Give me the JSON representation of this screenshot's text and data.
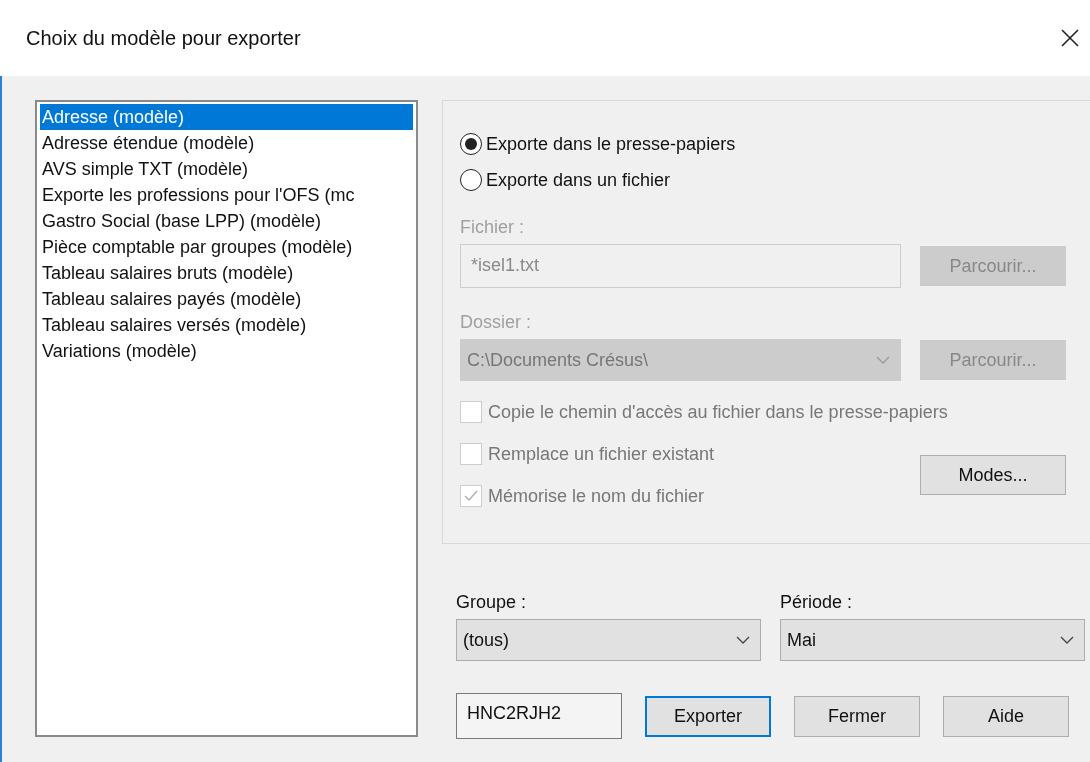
{
  "window": {
    "title": "Choix du modèle pour exporter"
  },
  "models": [
    {
      "label": "Adresse (modèle)",
      "selected": true
    },
    {
      "label": "Adresse étendue (modèle)",
      "selected": false
    },
    {
      "label": "AVS simple TXT (modèle)",
      "selected": false
    },
    {
      "label": "Exporte les professions pour l'OFS (mc",
      "selected": false
    },
    {
      "label": "Gastro Social (base LPP) (modèle)",
      "selected": false
    },
    {
      "label": "Pièce comptable par groupes (modèle)",
      "selected": false
    },
    {
      "label": "Tableau salaires bruts (modèle)",
      "selected": false
    },
    {
      "label": "Tableau salaires payés (modèle)",
      "selected": false
    },
    {
      "label": "Tableau salaires versés (modèle)",
      "selected": false
    },
    {
      "label": "Variations (modèle)",
      "selected": false
    }
  ],
  "export_targets": [
    {
      "label": "Exporte dans le presse-papiers",
      "selected": true
    },
    {
      "label": "Exporte dans un fichier",
      "selected": false
    }
  ],
  "file": {
    "label": "Fichier :",
    "value": "*isel1.txt",
    "browse": "Parcourir...",
    "disabled": true
  },
  "folder": {
    "label": "Dossier :",
    "value": "C:\\Documents Crésus\\",
    "browse": "Parcourir...",
    "disabled": true
  },
  "options": [
    {
      "label": "Copie le chemin d'accès au fichier dans le presse-papiers",
      "checked": false,
      "disabled": true
    },
    {
      "label": "Remplace un fichier existant",
      "checked": false,
      "disabled": true
    },
    {
      "label": "Mémorise le nom du fichier",
      "checked": true,
      "disabled": true
    }
  ],
  "modes_button": "Modes...",
  "group": {
    "label": "Groupe :",
    "value": "(tous)"
  },
  "period": {
    "label": "Période :",
    "value": "Mai"
  },
  "code": {
    "value": "HNC2RJH2"
  },
  "buttons": [
    {
      "label": "Exporter",
      "default": true
    },
    {
      "label": "Fermer",
      "default": false
    },
    {
      "label": "Aide",
      "default": false
    }
  ]
}
